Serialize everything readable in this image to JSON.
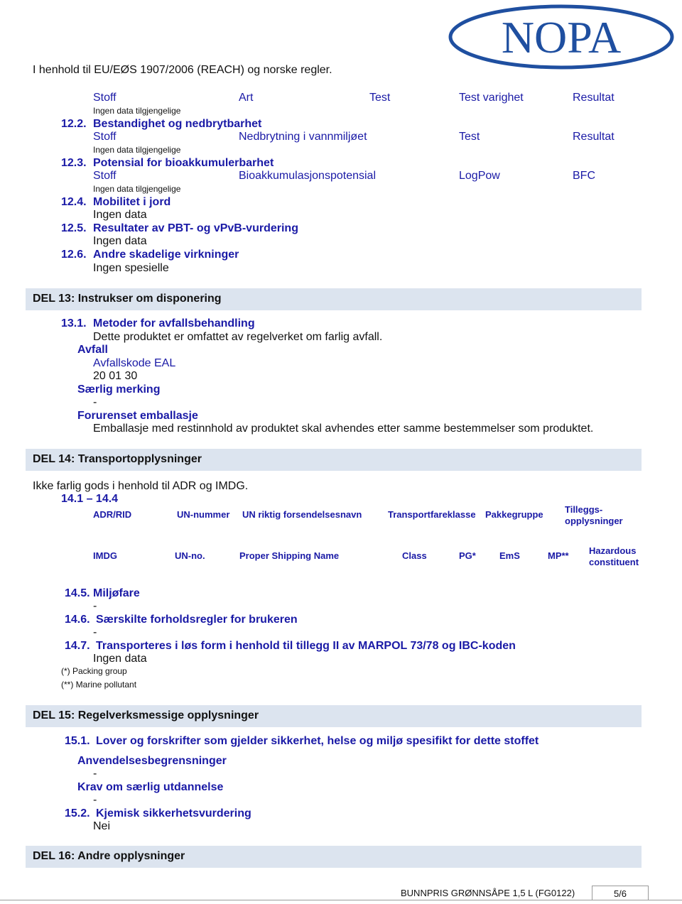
{
  "header": {
    "regulation_text": "I henhold til EU/EØS 1907/2006 (REACH) og norske regler.",
    "logo_text": "NOPA",
    "logo_color": "#1f4fa0"
  },
  "section12": {
    "toxicity_table": {
      "headers": [
        "Stoff",
        "Art",
        "Test",
        "Test varighet",
        "Resultat"
      ],
      "note": "Ingen data tilgjengelige"
    },
    "s12_2": {
      "number": "12.2.",
      "title": "Bestandighet og nedbrytbarhet",
      "headers": [
        "Stoff",
        "Nedbrytning i vannmiljøet",
        "Test",
        "Resultat"
      ],
      "note": "Ingen data tilgjengelige"
    },
    "s12_3": {
      "number": "12.3.",
      "title": "Potensial for bioakkumulerbarhet",
      "headers": [
        "Stoff",
        "Bioakkumulasjonspotensial",
        "LogPow",
        "BFC"
      ],
      "note": "Ingen data tilgjengelige"
    },
    "s12_4": {
      "number": "12.4.",
      "title": "Mobilitet i jord",
      "text": "Ingen data"
    },
    "s12_5": {
      "number": "12.5.",
      "title": "Resultater av PBT- og vPvB-vurdering",
      "text": "Ingen data"
    },
    "s12_6": {
      "number": "12.6.",
      "title": "Andre skadelige virkninger",
      "text": "Ingen spesielle"
    }
  },
  "section13": {
    "heading": "DEL 13: Instrukser om disponering",
    "s13_1": {
      "number": "13.1.",
      "title": "Metoder for avfallsbehandling",
      "text": "Dette produktet er omfattet av regelverket om farlig avfall."
    },
    "avfall": {
      "label": "Avfall",
      "code_label": "Avfallskode EAL",
      "code_value": "20 01 30"
    },
    "saerlig_merking": {
      "label": "Særlig merking",
      "value": "-"
    },
    "forurenset": {
      "label": "Forurenset emballasje",
      "text": "Emballasje med restinnhold av produktet skal avhendes etter samme bestemmelser som produktet."
    }
  },
  "section14": {
    "heading": "DEL 14: Transportopplysninger",
    "intro": "Ikke farlig gods i henhold til ADR og IMDG.",
    "range": "14.1 – 14.4",
    "adr_headers": [
      "ADR/RID",
      "UN-nummer",
      "UN riktig forsendelsesnavn",
      "Transportfareklasse",
      "Pakkegruppe",
      "Tilleggs-",
      "opplysninger"
    ],
    "imdg_headers": [
      "IMDG",
      "UN-no.",
      "Proper Shipping Name",
      "Class",
      "PG*",
      "EmS",
      "MP**",
      "Hazardous",
      "constituent"
    ],
    "s14_5": {
      "number": "14.5.",
      "title": "Miljøfare",
      "value": "-"
    },
    "s14_6": {
      "number": "14.6.",
      "title": "Særskilte forholdsregler for brukeren",
      "value": "-"
    },
    "s14_7": {
      "number": "14.7.",
      "title": "Transporteres i løs form i henhold til tillegg II av MARPOL 73/78 og IBC-koden",
      "value": "Ingen data"
    },
    "footnotes": [
      "(*) Packing group",
      "(**) Marine pollutant"
    ]
  },
  "section15": {
    "heading": "DEL 15: Regelverksmessige opplysninger",
    "s15_1": {
      "number": "15.1.",
      "title": "Lover og forskrifter som gjelder sikkerhet, helse og miljø spesifikt for dette stoffet"
    },
    "anvendelse": {
      "label": "Anvendelsesbegrensninger",
      "value": "-"
    },
    "krav": {
      "label": "Krav om særlig utdannelse",
      "value": "-"
    },
    "s15_2": {
      "number": "15.2.",
      "title": "Kjemisk sikkerhetsvurdering",
      "value": "Nei"
    }
  },
  "section16": {
    "heading": "DEL 16: Andre opplysninger"
  },
  "footer": {
    "product": "BUNNPRIS GRØNNSÅPE 1,5 L (FG0122)",
    "page": "5/6"
  }
}
